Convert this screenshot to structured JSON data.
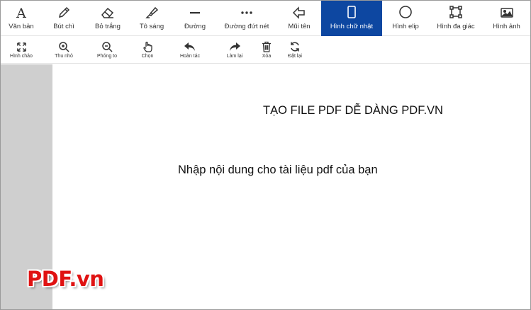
{
  "toolbar": {
    "tools": [
      {
        "label": "Văn bản",
        "icon": "text-icon"
      },
      {
        "label": "Bút chì",
        "icon": "pencil-icon"
      },
      {
        "label": "Bỏ trắng",
        "icon": "eraser-icon"
      },
      {
        "label": "Tô sáng",
        "icon": "highlighter-icon"
      },
      {
        "label": "Đường",
        "icon": "line-icon"
      },
      {
        "label": "Đường đứt nét",
        "icon": "dashed-line-icon"
      },
      {
        "label": "Mũi tên",
        "icon": "arrow-icon"
      },
      {
        "label": "Hình chữ nhật",
        "icon": "rectangle-icon",
        "active": true
      },
      {
        "label": "Hình elip",
        "icon": "ellipse-icon"
      },
      {
        "label": "Hình đa giác",
        "icon": "polygon-icon"
      },
      {
        "label": "Hình ảnh",
        "icon": "image-icon"
      }
    ],
    "active_color": "#0d47a1"
  },
  "subtoolbar": {
    "items": [
      {
        "label": "Hình chảo",
        "icon": "expand-icon"
      },
      {
        "label": "Thu nhỏ",
        "icon": "zoom-in-icon"
      },
      {
        "label": "Phóng to",
        "icon": "zoom-out-icon"
      },
      {
        "label": "Chọn",
        "icon": "hand-pointer-icon"
      },
      {
        "label": "Hoàn tác",
        "icon": "undo-icon"
      },
      {
        "label": "Làm lại",
        "icon": "redo-icon"
      },
      {
        "label": "Xóa",
        "icon": "trash-icon"
      },
      {
        "label": "Đặt lại",
        "icon": "reset-icon"
      }
    ]
  },
  "document": {
    "heading": "TẠO FILE PDF DỄ DÀNG PDF.VN",
    "body": "Nhập nội dung cho tài liệu pdf của bạn"
  },
  "watermark": {
    "text": "PDF.vn",
    "color": "#e01212"
  }
}
